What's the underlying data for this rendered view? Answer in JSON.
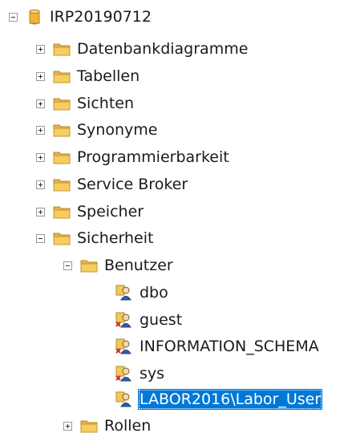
{
  "tree": {
    "root": {
      "label": "IRP20190712",
      "icon": "database-icon",
      "expanded": true
    },
    "folders": [
      {
        "label": "Datenbankdiagramme",
        "icon": "folder-icon",
        "expanded": false
      },
      {
        "label": "Tabellen",
        "icon": "folder-icon",
        "expanded": false
      },
      {
        "label": "Sichten",
        "icon": "folder-icon",
        "expanded": false
      },
      {
        "label": "Synonyme",
        "icon": "folder-icon",
        "expanded": false
      },
      {
        "label": "Programmierbarkeit",
        "icon": "folder-icon",
        "expanded": false
      },
      {
        "label": "Service Broker",
        "icon": "folder-icon",
        "expanded": false
      },
      {
        "label": "Speicher",
        "icon": "folder-icon",
        "expanded": false
      },
      {
        "label": "Sicherheit",
        "icon": "folder-icon",
        "expanded": true
      }
    ],
    "security": {
      "users_folder": {
        "label": "Benutzer",
        "icon": "folder-icon",
        "expanded": true
      },
      "users": [
        {
          "label": "dbo",
          "icon": "user-icon"
        },
        {
          "label": "guest",
          "icon": "disabled-user-icon"
        },
        {
          "label": "INFORMATION_SCHEMA",
          "icon": "disabled-user-icon"
        },
        {
          "label": "sys",
          "icon": "disabled-user-icon"
        },
        {
          "label": "LABOR2016\\Labor_User",
          "icon": "user-icon",
          "selected": true
        }
      ],
      "roles_folder": {
        "label": "Rollen",
        "icon": "folder-icon",
        "expanded": false
      }
    }
  },
  "colors": {
    "selection": "#0078d7",
    "folder": "#f3c64b",
    "database": "#d8a431"
  }
}
